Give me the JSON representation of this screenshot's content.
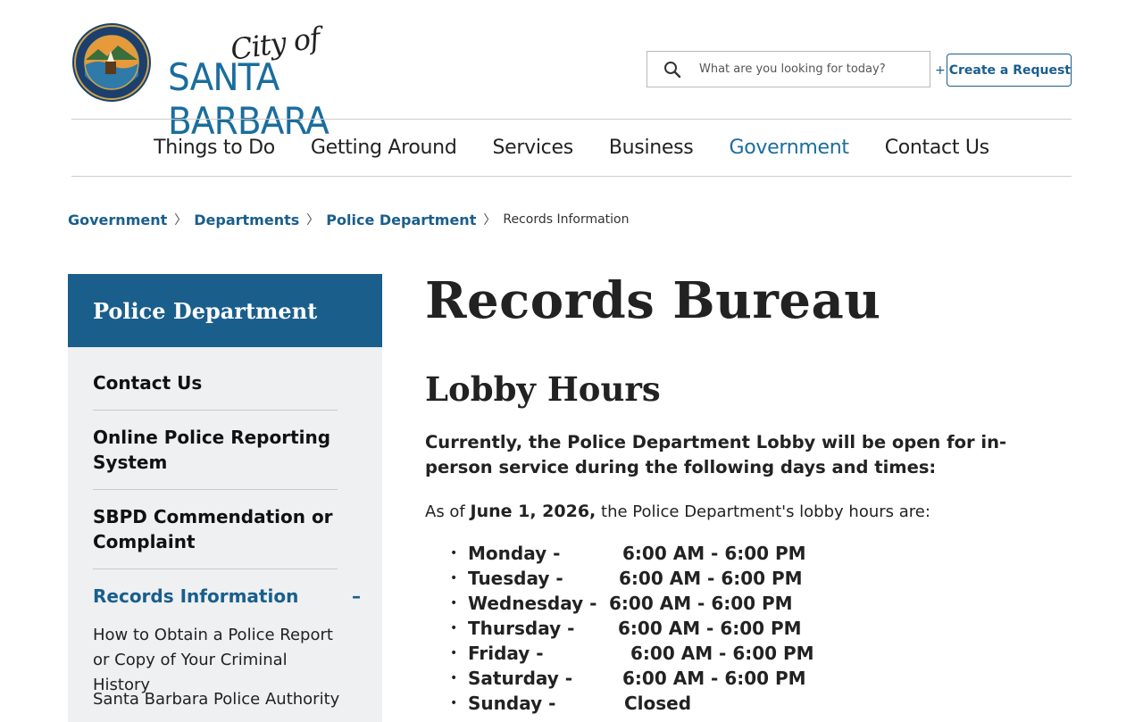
{
  "header": {
    "seal_alt": "City of Santa Barbara seal",
    "logo_script": "City of",
    "logo_name": "SANTA BARBARA",
    "search_placeholder": "What are you looking for today?",
    "create_button_plus": "+",
    "create_button_label": "Create a Request"
  },
  "nav": {
    "items": [
      {
        "label": "Things to Do"
      },
      {
        "label": "Getting Around"
      },
      {
        "label": "Services"
      },
      {
        "label": "Business"
      },
      {
        "label": "Government",
        "active": true
      },
      {
        "label": "Contact Us"
      }
    ]
  },
  "breadcrumb": {
    "items": [
      "Government",
      "Departments",
      "Police Department"
    ],
    "separator": "〉",
    "current": "Records Information"
  },
  "sidebar": {
    "title": "Police Department",
    "items": [
      {
        "label": "Contact Us"
      },
      {
        "label": "Online Police Reporting System"
      },
      {
        "label": "SBPD Commendation or Complaint"
      },
      {
        "label": "Records Information",
        "expanded_symbol": "–"
      }
    ],
    "subitems": [
      {
        "label": "How to Obtain a Police Report or Copy of Your Criminal History"
      },
      {
        "label": "Santa Barbara Police Authority"
      }
    ]
  },
  "main": {
    "title": "Records Bureau",
    "subtitle": "Lobby Hours",
    "lead": "Currently, the Police Department Lobby will be open for in-person service during the following days and times:",
    "as_of_prefix": "As of",
    "as_of_date": "June 1, 2026,",
    "as_of_suffix": "the Police Department's lobby hours are:",
    "bullet": "•",
    "hours": [
      {
        "day": "Monday -",
        "time": "6:00 AM - 6:00 PM"
      },
      {
        "day": "Tuesday -",
        "time": "6:00 AM - 6:00 PM"
      },
      {
        "day": "Wednesday -",
        "time": "6:00 AM - 6:00 PM"
      },
      {
        "day": "Thursday -",
        "time": "6:00 AM - 6:00 PM"
      },
      {
        "day": "Friday -",
        "time": "6:00 AM - 6:00 PM"
      },
      {
        "day": "Saturday -",
        "time": "6:00 AM - 6:00 PM"
      },
      {
        "day": "Sunday -",
        "time": "Closed"
      }
    ]
  },
  "colors": {
    "brand_blue": "#1a5e8c",
    "link_blue": "#1a6d9e",
    "sidebar_bg": "#eef0f2"
  }
}
